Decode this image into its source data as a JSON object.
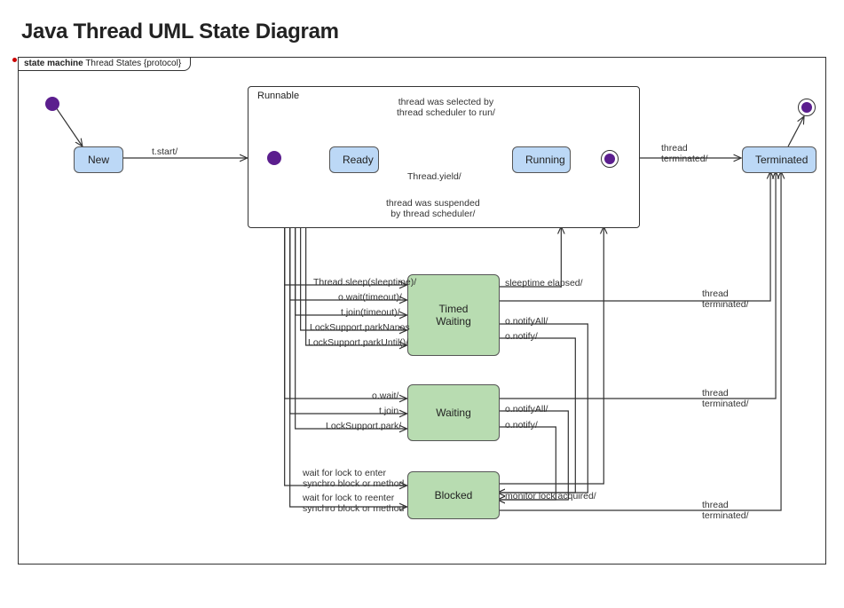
{
  "title": "Java Thread UML State Diagram",
  "frame": {
    "type": "state machine",
    "name": "Thread States {protocol}"
  },
  "states": {
    "new": "New",
    "runnable_region": "Runnable",
    "ready": "Ready",
    "running": "Running",
    "timed_waiting": "Timed Waiting",
    "waiting": "Waiting",
    "blocked": "Blocked",
    "terminated": "Terminated"
  },
  "transitions": {
    "new_to_runnable": "t.start/",
    "ready_to_running": "thread was selected by\nthread scheduler to run/",
    "running_to_ready_yield": "Thread.yield/",
    "running_to_ready_suspended": "thread was suspended\nby thread scheduler/",
    "running_to_final": "thread\nterminated/",
    "sleep": "Thread.sleep(sleeptime)/",
    "wait_timeout": "o.wait(timeout)/",
    "join_timeout": "t.join(timeout)/",
    "park_nanos": "LockSupport.parkNanos",
    "park_until": "LockSupport.parkUntil()/",
    "sleeptime_elapsed": "sleeptime elapsed/",
    "tw_notifyAll": "o.notifyAll/",
    "tw_notify": "o.notify/",
    "tw_terminated": "thread\nterminated/",
    "wait": "o.wait/",
    "join": "t.join",
    "park": "LockSupport.park/",
    "w_notifyAll": "o.notifyAll/",
    "w_notify": "o.notify/",
    "w_terminated": "thread\nterminated/",
    "lock_enter": "wait for lock to enter\nsynchro block or method",
    "lock_reenter": "wait for lock to reenter\nsynchro block or method",
    "monitor_acquired": "monitor lock acquired/",
    "b_terminated": "thread\nterminated/"
  }
}
